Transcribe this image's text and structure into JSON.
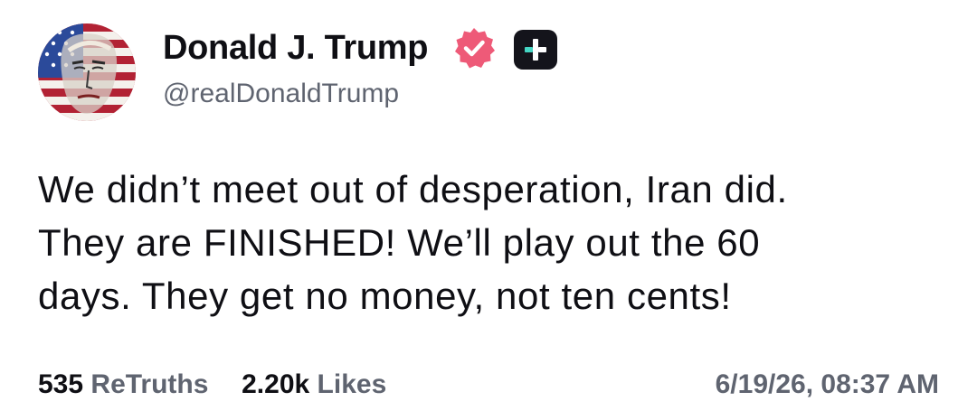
{
  "post": {
    "author": {
      "display_name": "Donald J. Trump",
      "handle": "@realDonaldTrump",
      "avatar_icon": "flag-portrait-avatar",
      "verified_icon": "verified-badge-icon",
      "subscription_icon": "plus-badge-icon"
    },
    "text_lines": [
      "We didn’t meet out of desperation, Iran did.",
      "They are FINISHED! We’ll play out the 60",
      "days. They get no money, not ten cents!"
    ],
    "stats": {
      "retruths_count": "535",
      "retruths_label": "ReTruths",
      "likes_count": "2.20k",
      "likes_label": "Likes"
    },
    "timestamp": "6/19/26, 08:37 AM"
  },
  "colors": {
    "text_primary": "#0f0f14",
    "text_secondary": "#5f6470",
    "verified_badge": "#ee5a78",
    "plus_badge": "#14141b",
    "avatar_red": "#b22234",
    "avatar_blue": "#2b4a9a"
  }
}
